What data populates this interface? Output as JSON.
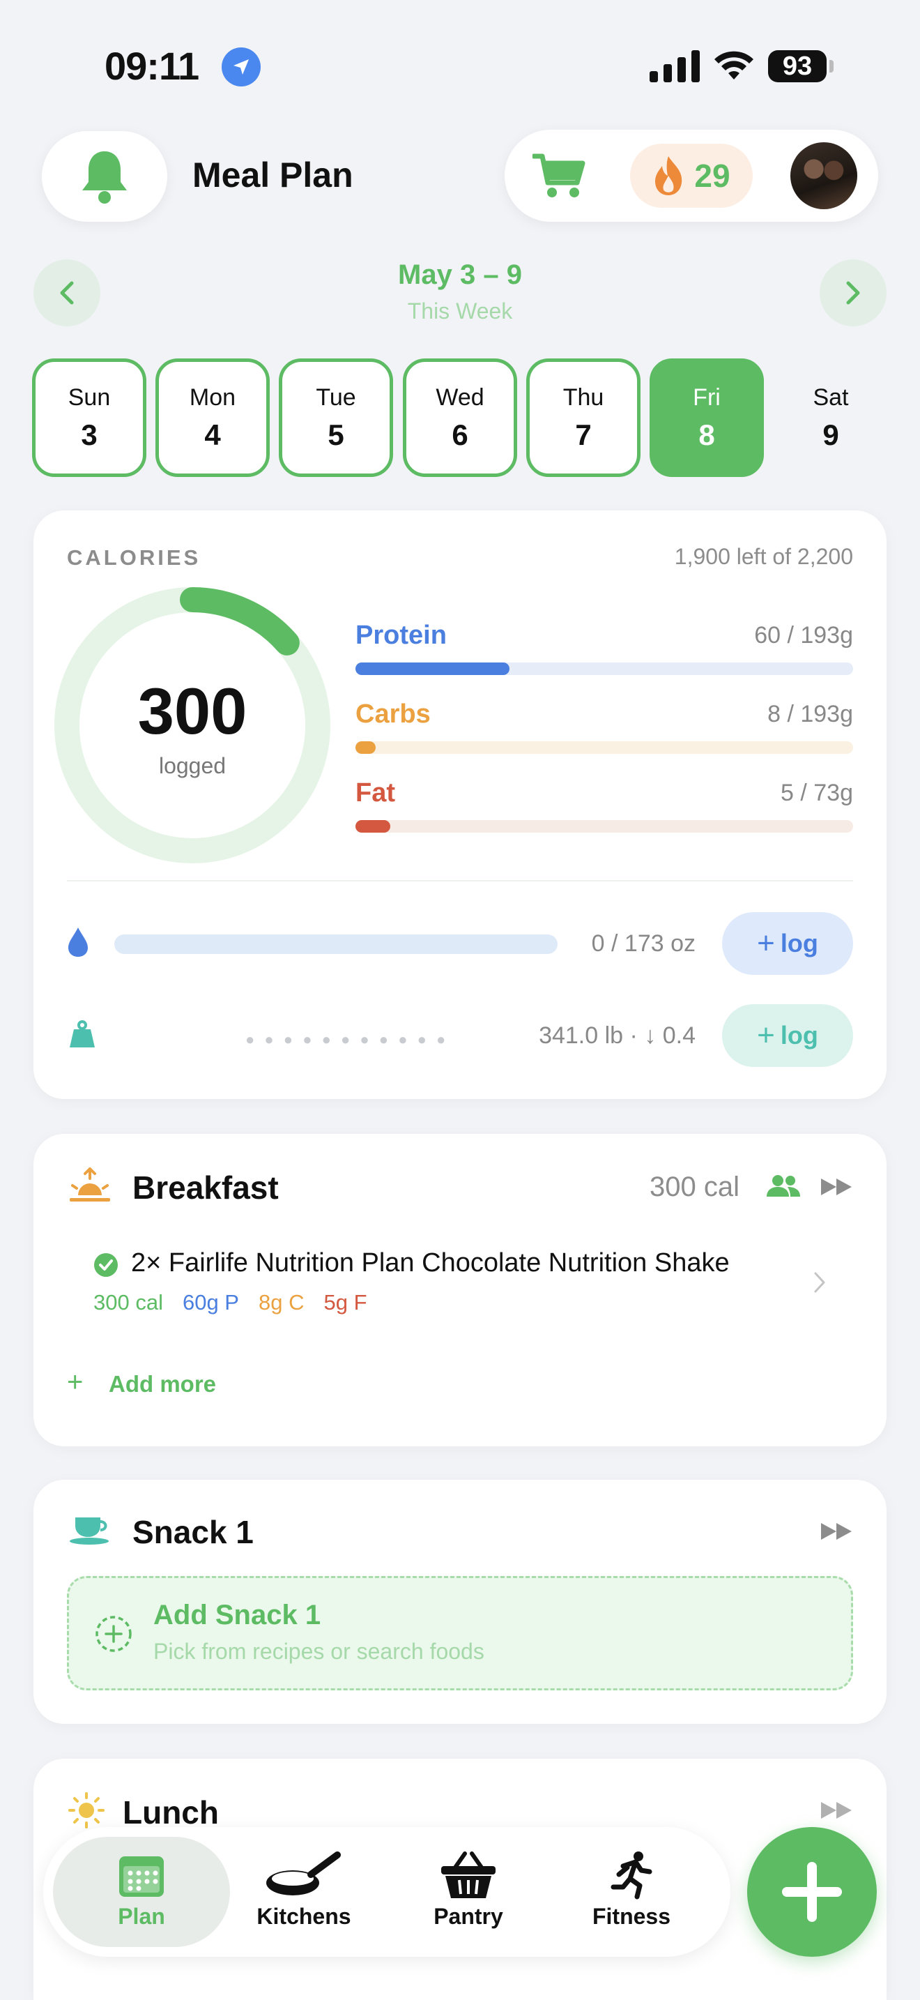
{
  "status_bar": {
    "time": "09:11",
    "battery": "93"
  },
  "header": {
    "title": "Meal Plan",
    "streak": "29"
  },
  "week": {
    "range": "May 3 – 9",
    "subtitle": "This Week"
  },
  "days": [
    {
      "name": "Sun",
      "num": "3"
    },
    {
      "name": "Mon",
      "num": "4"
    },
    {
      "name": "Tue",
      "num": "5"
    },
    {
      "name": "Wed",
      "num": "6"
    },
    {
      "name": "Thu",
      "num": "7"
    },
    {
      "name": "Fri",
      "num": "8"
    },
    {
      "name": "Sat",
      "num": "9"
    }
  ],
  "selected_day": "Fri",
  "calories": {
    "label": "CALORIES",
    "remaining": "1,900 left of 2,200",
    "logged": "300",
    "logged_label": "logged",
    "progress_fraction": 0.136,
    "macros": [
      {
        "name": "Protein",
        "value": "60 / 193g",
        "fraction": 0.31,
        "color": "#4a7fe0",
        "track": "#e6edf8"
      },
      {
        "name": "Carbs",
        "value": "8 / 193g",
        "fraction": 0.04,
        "color": "#eba13f",
        "track": "#fbf1e2"
      },
      {
        "name": "Fat",
        "value": "5 / 73g",
        "fraction": 0.07,
        "color": "#d4583f",
        "track": "#f7ece5"
      }
    ]
  },
  "water": {
    "value": "0 / 173 oz",
    "fraction": 0,
    "button": "log"
  },
  "weight": {
    "value": "341.0 lb · ↓ 0.4",
    "button": "log"
  },
  "breakfast": {
    "title": "Breakfast",
    "calories": "300 cal",
    "item": {
      "name": "2× Fairlife Nutrition Plan Chocolate Nutrition Shake",
      "cal": "300 cal",
      "protein": "60g P",
      "carbs": "8g C",
      "fat": "5g F"
    },
    "add_more": "Add more"
  },
  "snack1": {
    "title": "Snack 1",
    "add_title": "Add Snack 1",
    "add_subtitle": "Pick from recipes or search foods"
  },
  "lunch": {
    "title": "Lunch"
  },
  "tabs": [
    {
      "label": "Plan",
      "icon": "calendar-icon"
    },
    {
      "label": "Kitchens",
      "icon": "pan-icon"
    },
    {
      "label": "Pantry",
      "icon": "basket-icon"
    },
    {
      "label": "Fitness",
      "icon": "runner-icon"
    }
  ],
  "colors": {
    "accent": "#5dbb63",
    "background": "#f2f3f7"
  }
}
